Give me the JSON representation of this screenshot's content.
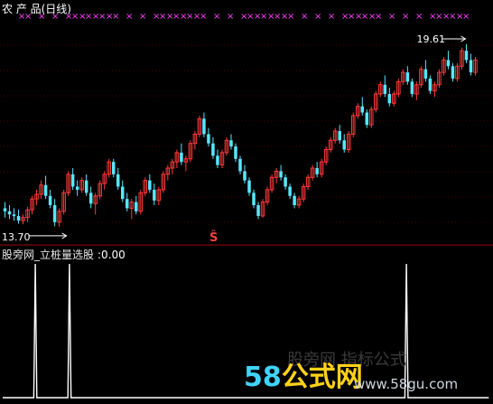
{
  "header": {
    "title": "农 产 品(日线)"
  },
  "indicator": {
    "name": "股旁网_立桩量选股",
    "value_text": ":0.00"
  },
  "annotations": {
    "high_label": "19.61",
    "low_label": "13.70",
    "signal_glyph": "Ŝ"
  },
  "watermark": {
    "faint": "股旁网 指标公式",
    "brand_num": "58",
    "brand_cn": "公式网",
    "url": "www.58gu.com"
  },
  "colors": {
    "up": "#ff3a3a",
    "down": "#58e6ff",
    "cross": "#ff40ff",
    "separator": "#a00000",
    "grid": "#4a0000",
    "indicator": "#ffffff"
  },
  "chart_data": [
    {
      "type": "candlestick",
      "title": "农 产 品(日线)",
      "ylim": [
        13.2,
        20.4
      ],
      "max_label": 19.61,
      "min_label": 13.7,
      "crosses": 50,
      "ohlc": [
        [
          14.3,
          14.5,
          14.0,
          14.2
        ],
        [
          14.2,
          14.4,
          13.95,
          14.1
        ],
        [
          14.1,
          14.3,
          13.9,
          14.05
        ],
        [
          14.05,
          14.25,
          13.8,
          13.9
        ],
        [
          13.9,
          14.1,
          13.78,
          14.0
        ],
        [
          14.0,
          14.35,
          13.85,
          14.25
        ],
        [
          14.25,
          14.7,
          14.1,
          14.6
        ],
        [
          14.6,
          14.9,
          14.4,
          14.75
        ],
        [
          14.75,
          15.2,
          14.6,
          15.05
        ],
        [
          15.05,
          15.35,
          14.6,
          14.7
        ],
        [
          14.7,
          14.9,
          14.3,
          14.4
        ],
        [
          14.4,
          14.6,
          13.72,
          13.85
        ],
        [
          13.85,
          14.3,
          13.7,
          14.2
        ],
        [
          14.2,
          14.9,
          14.1,
          14.8
        ],
        [
          14.8,
          15.5,
          14.7,
          15.4
        ],
        [
          15.4,
          15.6,
          14.9,
          15.0
        ],
        [
          15.0,
          15.2,
          14.7,
          14.9
        ],
        [
          14.9,
          15.3,
          14.8,
          15.2
        ],
        [
          15.2,
          15.4,
          14.7,
          14.8
        ],
        [
          14.8,
          15.0,
          14.3,
          14.45
        ],
        [
          14.45,
          14.8,
          14.1,
          14.7
        ],
        [
          14.7,
          15.2,
          14.6,
          15.1
        ],
        [
          15.1,
          15.5,
          14.9,
          15.4
        ],
        [
          15.4,
          15.9,
          15.3,
          15.8
        ],
        [
          15.8,
          15.9,
          15.3,
          15.4
        ],
        [
          15.4,
          15.6,
          14.9,
          15.0
        ],
        [
          15.0,
          15.2,
          14.5,
          14.6
        ],
        [
          14.6,
          14.8,
          14.2,
          14.3
        ],
        [
          14.3,
          14.6,
          13.95,
          14.5
        ],
        [
          14.5,
          14.7,
          14.1,
          14.2
        ],
        [
          14.2,
          14.9,
          14.1,
          14.8
        ],
        [
          14.8,
          15.3,
          14.7,
          15.2
        ],
        [
          15.2,
          15.4,
          14.8,
          14.9
        ],
        [
          14.9,
          15.1,
          14.4,
          14.55
        ],
        [
          14.55,
          15.0,
          14.4,
          14.9
        ],
        [
          14.9,
          15.5,
          14.8,
          15.4
        ],
        [
          15.4,
          15.7,
          15.2,
          15.6
        ],
        [
          15.6,
          15.9,
          15.4,
          15.8
        ],
        [
          15.8,
          16.2,
          15.6,
          16.1
        ],
        [
          16.1,
          16.4,
          15.7,
          15.8
        ],
        [
          15.8,
          16.0,
          15.5,
          15.9
        ],
        [
          15.9,
          16.5,
          15.8,
          16.4
        ],
        [
          16.4,
          16.8,
          16.2,
          16.7
        ],
        [
          16.7,
          17.3,
          16.6,
          17.2
        ],
        [
          17.2,
          17.4,
          16.6,
          16.7
        ],
        [
          16.7,
          16.9,
          16.3,
          16.4
        ],
        [
          16.4,
          16.6,
          15.9,
          16.0
        ],
        [
          16.0,
          16.2,
          15.6,
          15.7
        ],
        [
          15.7,
          16.2,
          15.6,
          16.1
        ],
        [
          16.1,
          16.6,
          16.0,
          16.5
        ],
        [
          16.5,
          16.7,
          16.2,
          16.3
        ],
        [
          16.3,
          16.4,
          15.8,
          15.9
        ],
        [
          15.9,
          16.0,
          15.4,
          15.5
        ],
        [
          15.5,
          15.7,
          15.1,
          15.2
        ],
        [
          15.2,
          15.3,
          14.7,
          14.8
        ],
        [
          14.8,
          14.9,
          14.3,
          14.4
        ],
        [
          14.4,
          14.5,
          13.95,
          14.05
        ],
        [
          14.05,
          14.6,
          14.0,
          14.5
        ],
        [
          14.5,
          15.0,
          14.4,
          14.9
        ],
        [
          14.9,
          15.4,
          14.8,
          15.3
        ],
        [
          15.3,
          15.6,
          15.1,
          15.5
        ],
        [
          15.5,
          15.7,
          15.2,
          15.3
        ],
        [
          15.3,
          15.4,
          14.9,
          15.0
        ],
        [
          15.0,
          15.1,
          14.6,
          14.7
        ],
        [
          14.7,
          14.8,
          14.3,
          14.4
        ],
        [
          14.4,
          14.7,
          14.3,
          14.6
        ],
        [
          14.6,
          15.1,
          14.5,
          15.0
        ],
        [
          15.0,
          15.4,
          14.9,
          15.3
        ],
        [
          15.3,
          15.7,
          15.2,
          15.6
        ],
        [
          15.6,
          15.8,
          15.3,
          15.4
        ],
        [
          15.4,
          15.9,
          15.3,
          15.8
        ],
        [
          15.8,
          16.3,
          15.7,
          16.2
        ],
        [
          16.2,
          16.6,
          16.1,
          16.5
        ],
        [
          16.5,
          16.9,
          16.4,
          16.8
        ],
        [
          16.8,
          17.0,
          16.4,
          16.5
        ],
        [
          16.5,
          16.7,
          16.1,
          16.2
        ],
        [
          16.2,
          16.8,
          16.1,
          16.7
        ],
        [
          16.7,
          17.4,
          16.6,
          17.3
        ],
        [
          17.3,
          17.7,
          17.2,
          17.6
        ],
        [
          17.6,
          17.9,
          17.3,
          17.4
        ],
        [
          17.4,
          17.5,
          16.9,
          17.0
        ],
        [
          17.0,
          17.6,
          16.9,
          17.5
        ],
        [
          17.5,
          18.1,
          17.4,
          18.0
        ],
        [
          18.0,
          18.4,
          17.9,
          18.3
        ],
        [
          18.3,
          18.6,
          17.9,
          18.0
        ],
        [
          18.0,
          18.2,
          17.6,
          17.7
        ],
        [
          17.7,
          18.1,
          17.6,
          18.0
        ],
        [
          18.0,
          18.5,
          17.9,
          18.4
        ],
        [
          18.4,
          18.8,
          18.3,
          18.7
        ],
        [
          18.7,
          18.9,
          18.3,
          18.4
        ],
        [
          18.4,
          18.5,
          17.9,
          18.0
        ],
        [
          18.0,
          18.4,
          17.8,
          18.3
        ],
        [
          18.3,
          18.9,
          18.2,
          18.8
        ],
        [
          18.8,
          19.1,
          18.4,
          18.5
        ],
        [
          18.5,
          18.6,
          18.0,
          18.1
        ],
        [
          18.1,
          18.4,
          17.9,
          18.3
        ],
        [
          18.3,
          18.8,
          18.2,
          18.7
        ],
        [
          18.7,
          19.2,
          18.6,
          19.1
        ],
        [
          19.1,
          19.4,
          18.8,
          18.9
        ],
        [
          18.9,
          19.0,
          18.4,
          18.5
        ],
        [
          18.5,
          19.0,
          18.4,
          18.9
        ],
        [
          18.9,
          19.5,
          18.8,
          19.4
        ],
        [
          19.4,
          19.61,
          19.0,
          19.1
        ],
        [
          19.1,
          19.3,
          18.6,
          18.7
        ],
        [
          18.7,
          19.2,
          18.6,
          19.1
        ]
      ]
    },
    {
      "type": "line",
      "title": "股旁网_立桩量选股",
      "ylim": [
        0,
        1
      ],
      "values": [
        0,
        0,
        0,
        0,
        0,
        0,
        0,
        0,
        0,
        0,
        0,
        0,
        0,
        0,
        0,
        0,
        0,
        0,
        0,
        0,
        0,
        1,
        0,
        0,
        0,
        0,
        0,
        0,
        0,
        0,
        0,
        0,
        0,
        0,
        0,
        0,
        0,
        0,
        0,
        0,
        0,
        0,
        0,
        1,
        0,
        0,
        0,
        0,
        0,
        0,
        0,
        0,
        0,
        0,
        0,
        0,
        0,
        0,
        0,
        0,
        0,
        0,
        0,
        0,
        0,
        0,
        0,
        0,
        0,
        0,
        0,
        0,
        0,
        0,
        0,
        0,
        0,
        0,
        0,
        0,
        0,
        0,
        0,
        0,
        0,
        0,
        0,
        0,
        0,
        0,
        0,
        0,
        0,
        0,
        0,
        0,
        0,
        0,
        0,
        0,
        0,
        0,
        0,
        0,
        0,
        0,
        0,
        0,
        0,
        0,
        0,
        0,
        0,
        0,
        0,
        0,
        0,
        0,
        0,
        0,
        0,
        0,
        0,
        0,
        0,
        0,
        0,
        0,
        0,
        0,
        0,
        0,
        0,
        0,
        0,
        0,
        0,
        0,
        0,
        0,
        0,
        0,
        0,
        0,
        0,
        0,
        0,
        0,
        0,
        0,
        0,
        0,
        0,
        0,
        0,
        0,
        0,
        0,
        0,
        0,
        0,
        0,
        0,
        0,
        0,
        0,
        0,
        0,
        0,
        0,
        0,
        0,
        0,
        0,
        0,
        0,
        0,
        0,
        0,
        0,
        0,
        0,
        0,
        0,
        0,
        0,
        0,
        0,
        0,
        0,
        0,
        0,
        0,
        0,
        0,
        0,
        0,
        0,
        0,
        0,
        0,
        0,
        0,
        0,
        0,
        0,
        0,
        0,
        0,
        0,
        0,
        0,
        0,
        0,
        0,
        0,
        0,
        0,
        0,
        0,
        0,
        0,
        0,
        0,
        0,
        0,
        0,
        0,
        0,
        0,
        0,
        0,
        0,
        0,
        0,
        0,
        0,
        0,
        0,
        0,
        0,
        0,
        0,
        0,
        0,
        0,
        0,
        0,
        0,
        0,
        0,
        0,
        0,
        0,
        0,
        0,
        0,
        0,
        0,
        0,
        1,
        0,
        0,
        0,
        0,
        0,
        0,
        0,
        0,
        0,
        0,
        0,
        0,
        0,
        0,
        0,
        0,
        0,
        0,
        0,
        0,
        0,
        0,
        0,
        0,
        0,
        0,
        0,
        0,
        0,
        0,
        0,
        0,
        0,
        0,
        0,
        0,
        0,
        0,
        0,
        0,
        0,
        0,
        0,
        0,
        0,
        0,
        0,
        0,
        0,
        0,
        0,
        0,
        0
      ]
    }
  ]
}
